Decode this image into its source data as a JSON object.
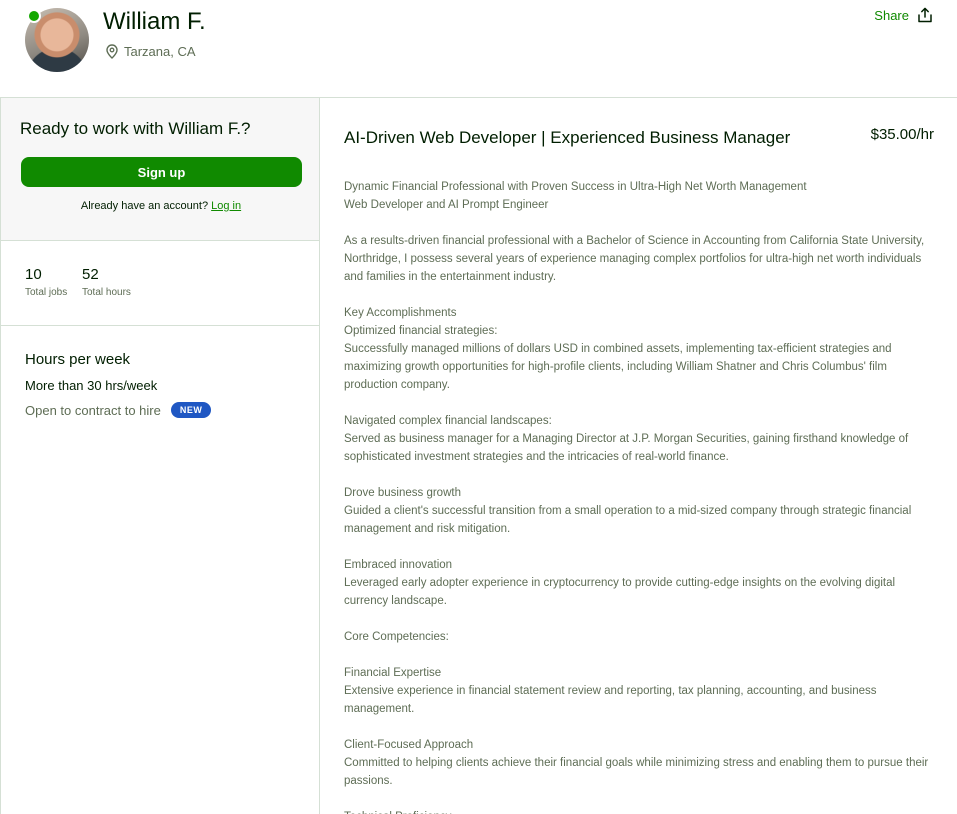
{
  "profile": {
    "name": "William F.",
    "location": "Tarzana, CA",
    "share_label": "Share"
  },
  "sidebar": {
    "cta_title": "Ready to work with William F.?",
    "signup_label": "Sign up",
    "login_prompt": "Already have an account?",
    "login_label": "Log in",
    "stats": [
      {
        "value": "10",
        "label": "Total jobs"
      },
      {
        "value": "52",
        "label": "Total hours"
      }
    ],
    "hours_title": "Hours per week",
    "hours_value": "More than 30 hrs/week",
    "contract_label": "Open to contract to hire",
    "new_badge": "NEW"
  },
  "main": {
    "title": "AI-Driven Web Developer | Experienced Business Manager",
    "rate": "$35.00/hr",
    "description": [
      "Dynamic Financial Professional with Proven Success in Ultra-High Net Worth Management",
      "Web Developer and AI Prompt Engineer",
      "",
      "As a results-driven financial professional with a Bachelor of Science in Accounting from California State University, Northridge, I possess several years of experience managing complex portfolios for ultra-high net worth individuals and families in the entertainment industry.",
      "",
      "Key Accomplishments",
      "Optimized financial strategies:",
      "Successfully managed millions of dollars USD in combined assets, implementing tax-efficient strategies and maximizing growth opportunities for high-profile clients, including William Shatner and Chris Columbus' film production company.",
      "",
      "Navigated complex financial landscapes:",
      "Served as business manager for a Managing Director at J.P. Morgan Securities, gaining firsthand knowledge of sophisticated investment strategies and the intricacies of real-world finance.",
      "",
      "Drove business growth",
      "Guided a client's successful transition from a small operation to a mid-sized company through strategic financial management and risk mitigation.",
      "",
      "Embraced innovation",
      "Leveraged early adopter experience in cryptocurrency to provide cutting-edge insights on the evolving digital currency landscape.",
      "",
      "Core Competencies:",
      "",
      "Financial Expertise",
      "Extensive experience in financial statement review and reporting, tax planning, accounting, and business management.",
      "",
      "Client-Focused Approach",
      "Committed to helping clients achieve their financial goals while minimizing stress and enabling them to pursue their passions.",
      "",
      "Technical Proficiency"
    ]
  },
  "colors": {
    "brand_green": "#108a00",
    "online_green": "#14a800",
    "badge_blue": "#1f57c3"
  }
}
